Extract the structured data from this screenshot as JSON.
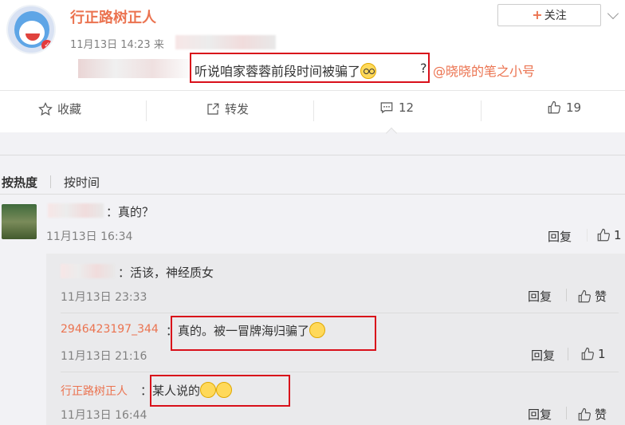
{
  "post": {
    "author": "行正路树正人",
    "time": "11月13日 14:23",
    "source_prefix": "来",
    "follow_label": "关注",
    "follow_plus": "+",
    "text": "听说咱家蓉蓉前段时间被骗了",
    "question_mark": "?",
    "mention": "@晓晓的笔之小号"
  },
  "actions": {
    "favorite": "收藏",
    "repost": "转发",
    "comment_count": "12",
    "like_count": "19"
  },
  "sort": {
    "hot": "按热度",
    "time": "按时间"
  },
  "comments": [
    {
      "text": "：真的？",
      "time": "11月13日 16:34",
      "reply": "回复",
      "like": "1",
      "replies": [
        {
          "user": "",
          "text": "：活该，神经质女",
          "time": "11月13日 23:33",
          "reply": "回复",
          "like": "赞"
        },
        {
          "user": "2946423197_344",
          "text": "：真的。被一冒牌海归骗了",
          "time": "11月13日 21:16",
          "reply": "回复",
          "like": "1"
        },
        {
          "user": "行正路树正人",
          "text": "：某人说的",
          "time": "11月13日 16:44",
          "reply": "回复",
          "like": "赞"
        }
      ]
    }
  ],
  "colors": {
    "accent": "#eb7350",
    "highlight_box": "#d9101a",
    "comment_bg": "#f2f2f5"
  }
}
